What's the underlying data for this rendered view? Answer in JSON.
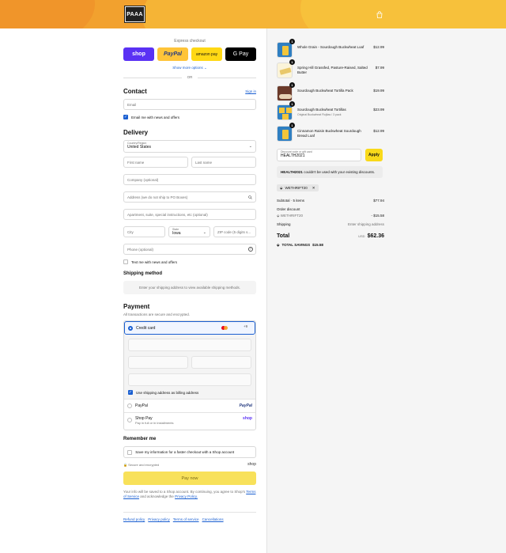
{
  "header": {
    "logo_text": "PAAA",
    "bag_icon": "shopping-bag-icon",
    "colors": {
      "header_bg": "#f2a12e"
    }
  },
  "express": {
    "title": "Express checkout",
    "buttons": {
      "shop": "shop",
      "paypal": "PayPal",
      "amazon": "amazon pay",
      "gpay": "G Pay"
    },
    "show_more": "Show more options ⌄",
    "or": "OR"
  },
  "contact": {
    "title": "Contact",
    "sign_in": "Sign in",
    "email_placeholder": "Email",
    "news_label": "Email me with news and offers"
  },
  "delivery": {
    "title": "Delivery",
    "country_label": "Country/Region",
    "country_value": "United States",
    "first_name": "First name",
    "last_name": "Last name",
    "company": "Company (optional)",
    "address": "Address (we do not ship to PO Boxes)",
    "apartment": "Apartment, suite, special instructions, etc (optional)",
    "city": "City",
    "state_label": "State",
    "state_value": "Iowa",
    "zip": "ZIP code (5 digits s...",
    "phone": "Phone (optional)",
    "text_me": "Text me with news and offers"
  },
  "shipping": {
    "title": "Shipping method",
    "info": "Enter your shipping address to view available shipping methods."
  },
  "payment": {
    "title": "Payment",
    "subtitle": "All transactions are secure and encrypted.",
    "credit_card": "Credit card",
    "more_cards": "+9",
    "billing_label": "Use shipping address as billing address",
    "paypal": "PayPal",
    "paypal_logo": "PayPal",
    "shop_pay": "Shop Pay",
    "shop_pay_sub": "Pay in full or in installments",
    "shop_logo": "shop"
  },
  "remember": {
    "title": "Remember me",
    "save_label": "Save my information for a faster checkout with a Shop account",
    "secure": "Secure and encrypted",
    "shop_logo": "shop"
  },
  "pay_now": "Pay now",
  "legal": {
    "line1": "Your info will be saved to a Shop account. By continuing, you agree to Shop's",
    "tos": "Terms of Service",
    "and": "and acknowledge the",
    "privacy": "Privacy Policy."
  },
  "footer": {
    "refund": "Refund policy",
    "privacy": "Privacy policy",
    "terms": "Terms of service",
    "cancel": "Cancellations"
  },
  "cart": {
    "items": [
      {
        "name": "Whole Grain - Sourdough Buckwheat Loaf",
        "sub": "",
        "price": "$12.99",
        "qty": "1"
      },
      {
        "name": "Spring Hill Grassfed, Pasture-Raised, Salted Butter",
        "sub": "",
        "price": "$7.99",
        "qty": "1"
      },
      {
        "name": "Sourdough Buckwheat Tortilla Pack",
        "sub": "",
        "price": "$19.99",
        "qty": "1"
      },
      {
        "name": "Sourdough Buckwheat Tortillas",
        "sub": "Original Buckwheat Flojitas / 3 pack",
        "price": "$23.99",
        "qty": "1"
      },
      {
        "name": "Cinnamon Raisin Buckwheat Sourdough Bread Loaf",
        "sub": "",
        "price": "$12.99",
        "qty": "1"
      }
    ],
    "discount_label": "Discount code or gift card",
    "discount_value": "HEALTH2021",
    "apply": "Apply",
    "error_code": "HEALTH2021",
    "error_text": "couldn't be used with your existing discounts.",
    "tag": "WETHRIFT20",
    "subtotal_label": "Subtotal · 5 items",
    "subtotal_value": "$77.94",
    "order_discount": "Order discount",
    "discount_code": "WETHRIFT20",
    "discount_amount": "- $15.58",
    "shipping_label": "Shipping",
    "shipping_value": "Enter shipping address",
    "total_label": "Total",
    "currency": "USD",
    "total_value": "$62.36",
    "savings_label": "TOTAL SAVINGS",
    "savings_value": "$15.58"
  }
}
